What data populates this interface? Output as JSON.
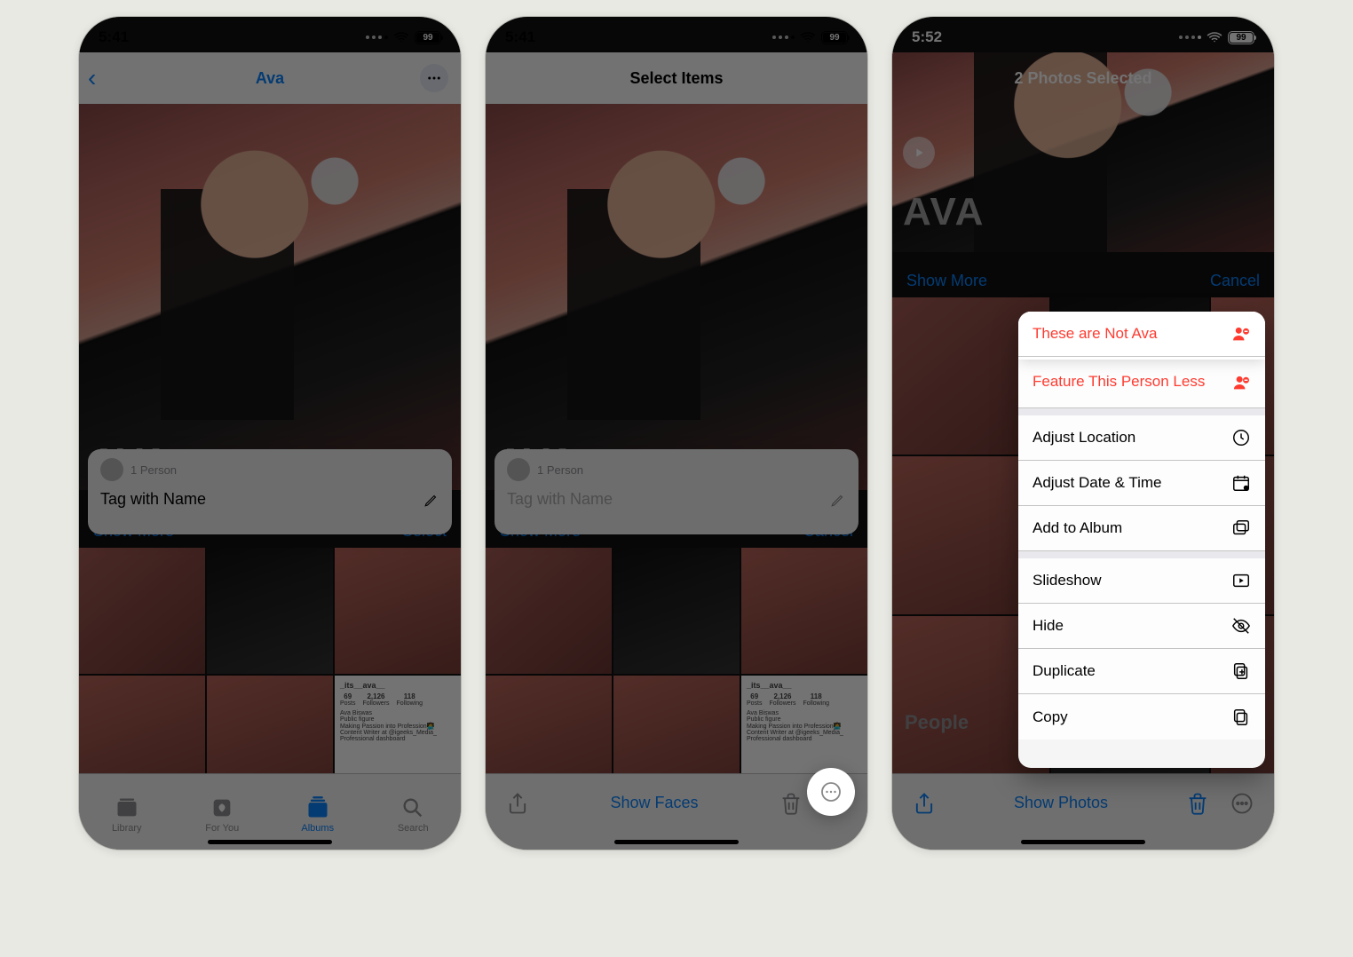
{
  "screens": {
    "s1": {
      "status": {
        "time": "5:41",
        "battery": "99"
      },
      "navbar": {
        "title": "Ava"
      },
      "hero": {
        "big_name": "AVA",
        "tag_head": "1 Person",
        "tag_placeholder": "Tag with Name"
      },
      "rowbar": {
        "left": "Show More",
        "right": "Select"
      },
      "tabbar": {
        "library": "Library",
        "foryou": "For You",
        "albums": "Albums",
        "search": "Search"
      }
    },
    "s2": {
      "status": {
        "time": "5:41",
        "battery": "99"
      },
      "navbar": {
        "title": "Select Items"
      },
      "hero": {
        "big_name": "AVA",
        "tag_head": "1 Person",
        "tag_placeholder": "Tag with Name"
      },
      "rowbar": {
        "left": "Show More",
        "right": "Cancel"
      },
      "toolbar": {
        "center": "Show Faces"
      }
    },
    "s3": {
      "status": {
        "time": "5:52",
        "battery": "99"
      },
      "navbar": {
        "title": "2 Photos Selected"
      },
      "hero": {
        "big_name": "AVA"
      },
      "rowbar": {
        "left": "Show More",
        "right": "Cancel"
      },
      "people_header": "People",
      "toolbar": {
        "center": "Show Photos"
      },
      "menu": {
        "not_person": "These are Not Ava",
        "feature_less": "Feature This Person Less",
        "adjust_loc": "Adjust Location",
        "adjust_date": "Adjust Date & Time",
        "add_album": "Add to Album",
        "slideshow": "Slideshow",
        "hide": "Hide",
        "duplicate": "Duplicate",
        "copy": "Copy"
      }
    }
  },
  "ig_card": {
    "handle": "_its__ava__",
    "posts": "69",
    "posts_label": "Posts",
    "followers": "2,126",
    "followers_label": "Followers",
    "following": "118",
    "following_label": "Following",
    "name": "Ava Biswas",
    "role": "Public figure",
    "line1": "Making Passion into Profession👩‍💻",
    "line2": "Content Writer at @igeeks_Media_",
    "line3": "Professional dashboard"
  }
}
